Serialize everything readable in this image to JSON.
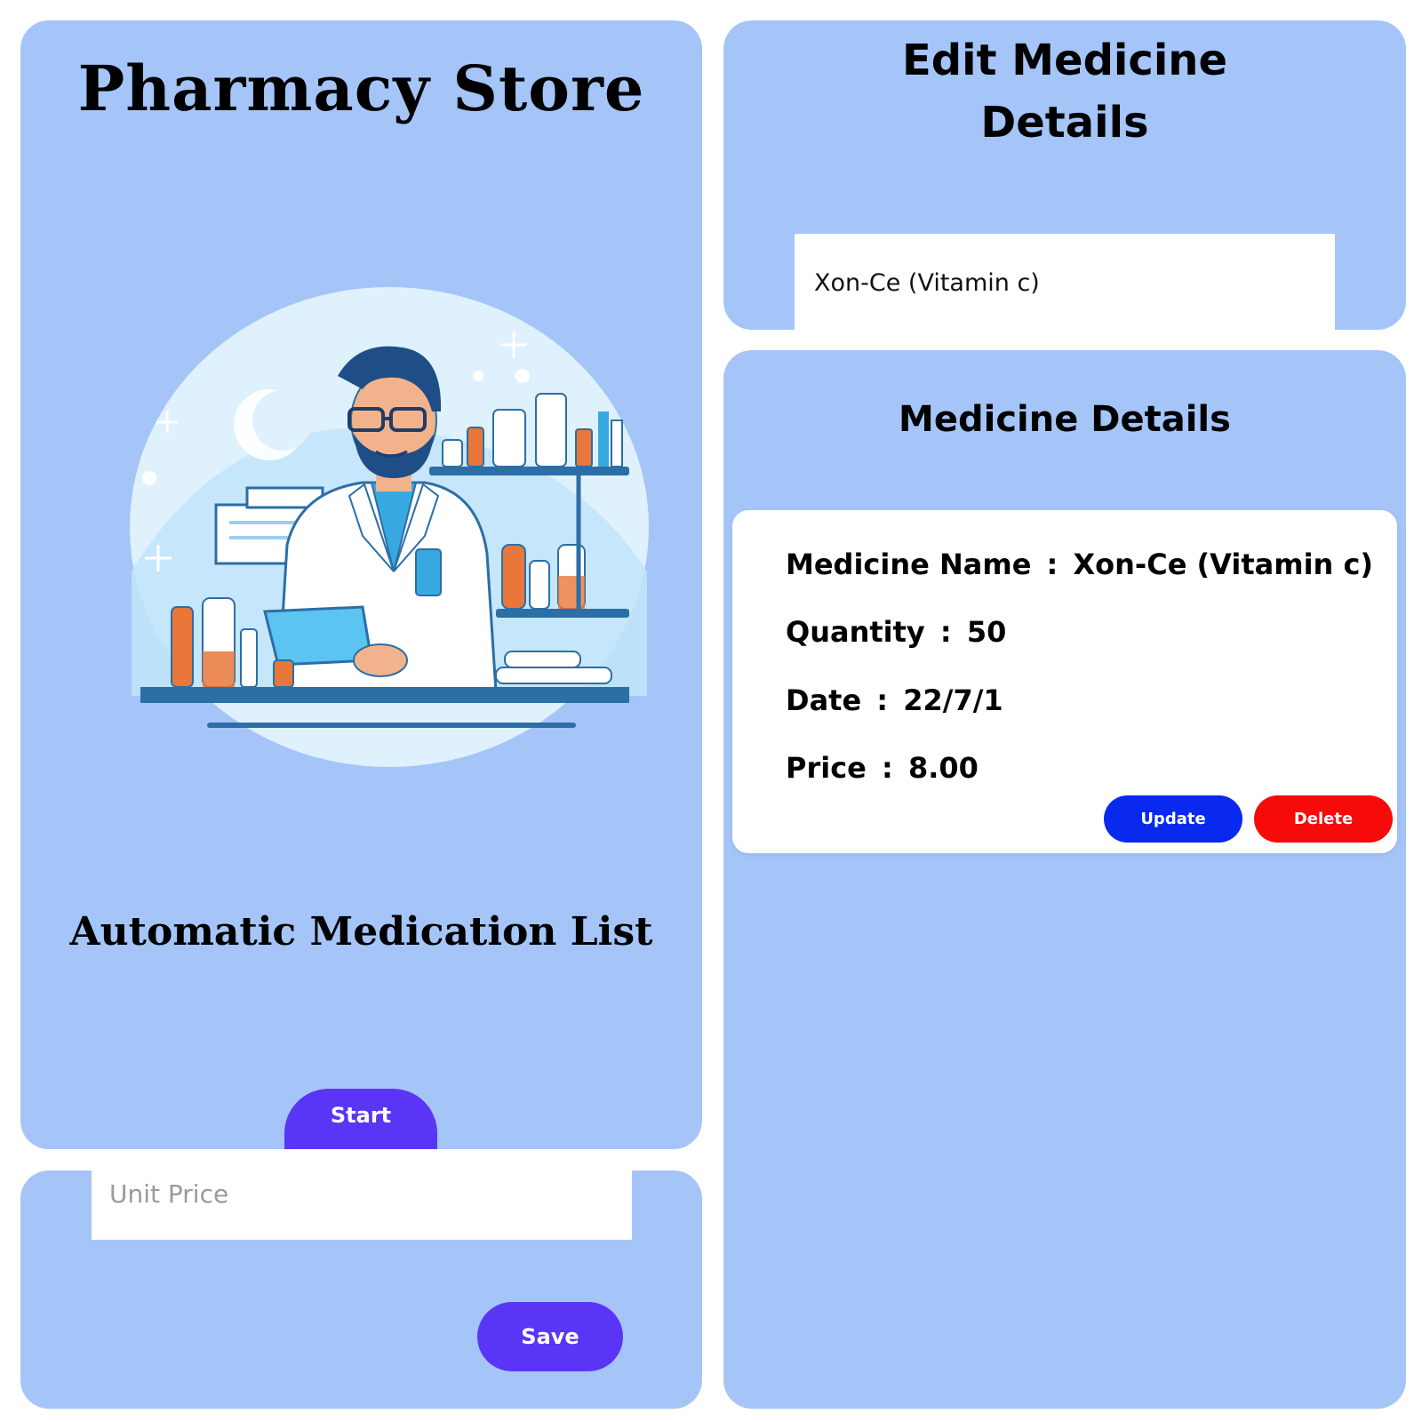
{
  "start_screen": {
    "title": "Pharmacy Store",
    "subtitle": "Automatic Medication List",
    "start_label": "Start",
    "illustration_icon": "pharmacist-icon"
  },
  "price_form": {
    "unit_price_placeholder": "Unit Price",
    "unit_price_value": "",
    "save_label": "Save"
  },
  "edit_screen": {
    "title_line1": "Edit Medicine",
    "title_line2": "Details",
    "medicine_value": "Xon-Ce (Vitamin c)"
  },
  "details_screen": {
    "title": "Medicine Details",
    "fields": {
      "name_label": "Medicine Name",
      "name_value": "Xon-Ce (Vitamin c)",
      "quantity_label": "Quantity",
      "quantity_value": "50",
      "date_label": "Date",
      "date_value": "22/7/1",
      "price_label": "Price",
      "price_value": "8.00"
    },
    "update_label": "Update",
    "delete_label": "Delete"
  },
  "colors": {
    "panel_bg": "#a5c5f8",
    "primary_purple": "#5b35f5",
    "update_blue": "#0a29ee",
    "delete_red": "#f70a0a",
    "card_bg": "#ffffff"
  }
}
